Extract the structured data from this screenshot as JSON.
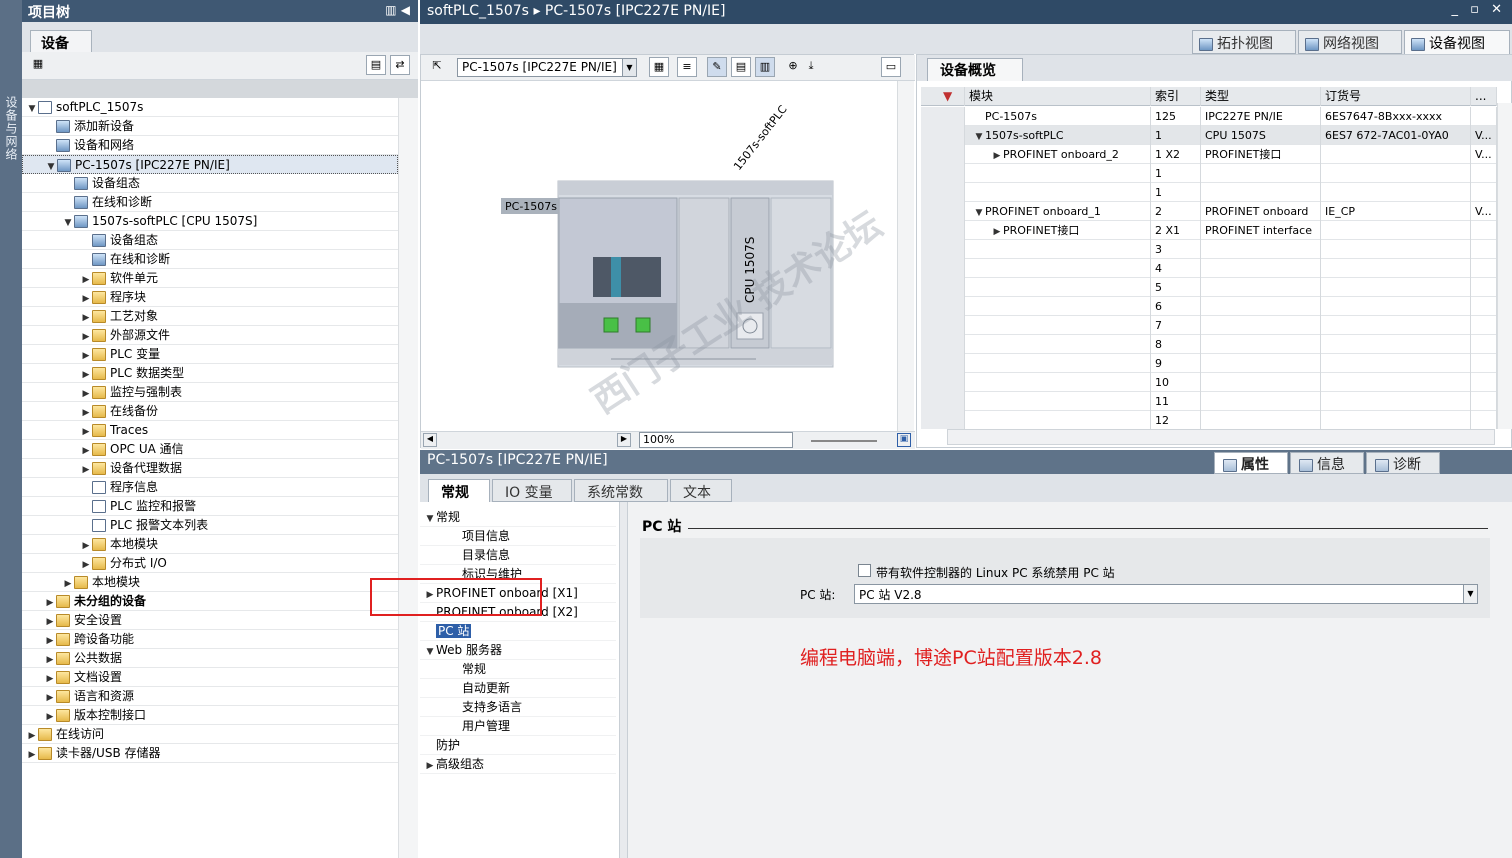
{
  "sidebar_strip": {
    "label": "设备与网络"
  },
  "project_tree": {
    "title": "项目树",
    "tab": "设备",
    "items": [
      {
        "label": "softPLC_1507s",
        "level": 0,
        "arrow": "▼",
        "icon": "doc"
      },
      {
        "label": "添加新设备",
        "level": 1,
        "arrow": "",
        "icon": "dev"
      },
      {
        "label": "设备和网络",
        "level": 1,
        "arrow": "",
        "icon": "dev"
      },
      {
        "label": "PC-1507s [IPC227E PN/IE]",
        "level": 1,
        "arrow": "▼",
        "icon": "dev",
        "selected": true
      },
      {
        "label": "设备组态",
        "level": 2,
        "arrow": "",
        "icon": "dev"
      },
      {
        "label": "在线和诊断",
        "level": 2,
        "arrow": "",
        "icon": "dev"
      },
      {
        "label": "1507s-softPLC [CPU 1507S]",
        "level": 2,
        "arrow": "▼",
        "icon": "dev"
      },
      {
        "label": "设备组态",
        "level": 3,
        "arrow": "",
        "icon": "dev"
      },
      {
        "label": "在线和诊断",
        "level": 3,
        "arrow": "",
        "icon": "dev"
      },
      {
        "label": "软件单元",
        "level": 3,
        "arrow": "▶",
        "icon": "fold"
      },
      {
        "label": "程序块",
        "level": 3,
        "arrow": "▶",
        "icon": "fold"
      },
      {
        "label": "工艺对象",
        "level": 3,
        "arrow": "▶",
        "icon": "fold"
      },
      {
        "label": "外部源文件",
        "level": 3,
        "arrow": "▶",
        "icon": "fold"
      },
      {
        "label": "PLC 变量",
        "level": 3,
        "arrow": "▶",
        "icon": "fold"
      },
      {
        "label": "PLC 数据类型",
        "level": 3,
        "arrow": "▶",
        "icon": "fold"
      },
      {
        "label": "监控与强制表",
        "level": 3,
        "arrow": "▶",
        "icon": "fold"
      },
      {
        "label": "在线备份",
        "level": 3,
        "arrow": "▶",
        "icon": "fold"
      },
      {
        "label": "Traces",
        "level": 3,
        "arrow": "▶",
        "icon": "fold"
      },
      {
        "label": "OPC UA 通信",
        "level": 3,
        "arrow": "▶",
        "icon": "fold"
      },
      {
        "label": "设备代理数据",
        "level": 3,
        "arrow": "▶",
        "icon": "fold"
      },
      {
        "label": "程序信息",
        "level": 3,
        "arrow": "",
        "icon": "doc"
      },
      {
        "label": "PLC 监控和报警",
        "level": 3,
        "arrow": "",
        "icon": "doc"
      },
      {
        "label": "PLC 报警文本列表",
        "level": 3,
        "arrow": "",
        "icon": "doc"
      },
      {
        "label": "本地模块",
        "level": 3,
        "arrow": "▶",
        "icon": "fold"
      },
      {
        "label": "分布式 I/O",
        "level": 3,
        "arrow": "▶",
        "icon": "fold"
      },
      {
        "label": "本地模块",
        "level": 2,
        "arrow": "▶",
        "icon": "fold"
      },
      {
        "label": "未分组的设备",
        "level": 1,
        "arrow": "▶",
        "icon": "fold",
        "bold": true
      },
      {
        "label": "安全设置",
        "level": 1,
        "arrow": "▶",
        "icon": "fold"
      },
      {
        "label": "跨设备功能",
        "level": 1,
        "arrow": "▶",
        "icon": "fold"
      },
      {
        "label": "公共数据",
        "level": 1,
        "arrow": "▶",
        "icon": "fold"
      },
      {
        "label": "文档设置",
        "level": 1,
        "arrow": "▶",
        "icon": "fold"
      },
      {
        "label": "语言和资源",
        "level": 1,
        "arrow": "▶",
        "icon": "fold"
      },
      {
        "label": "版本控制接口",
        "level": 1,
        "arrow": "▶",
        "icon": "fold"
      },
      {
        "label": "在线访问",
        "level": 0,
        "arrow": "▶",
        "icon": "fold"
      },
      {
        "label": "读卡器/USB 存储器",
        "level": 0,
        "arrow": "▶",
        "icon": "fold"
      }
    ]
  },
  "titlebar": {
    "project": "softPLC_1507s",
    "separator": "▸",
    "device": "PC-1507s [IPC227E PN/IE]",
    "controls": "_ ▫ ✕"
  },
  "view_tabs": [
    {
      "label": "拓扑视图",
      "active": false
    },
    {
      "label": "网络视图",
      "active": false
    },
    {
      "label": "设备视图",
      "active": true
    }
  ],
  "device_view": {
    "selector": "PC-1507s [IPC227E PN/IE]",
    "rack_label": "PC-1507s",
    "cpu_name": "1507s-softPLC",
    "cpu_text": "CPU 1507S",
    "zoom": "100%"
  },
  "overview": {
    "tab": "设备概览",
    "columns": [
      "模块",
      "索引",
      "类型",
      "订货号",
      "..."
    ],
    "rows": [
      {
        "module": "PC-1507s",
        "index": "125",
        "type": "IPC227E PN/IE",
        "order": "6ES7647-8Bxxx-xxxx",
        "more": "",
        "indent": 1,
        "arrow": ""
      },
      {
        "module": "1507s-softPLC",
        "index": "1",
        "type": "CPU 1507S",
        "order": "6ES7 672-7AC01-0YA0",
        "more": "V...",
        "indent": 1,
        "arrow": "▼",
        "hl": true
      },
      {
        "module": "PROFINET onboard_2",
        "index": "1 X2",
        "type": "PROFINET接口",
        "order": "",
        "more": "V...",
        "indent": 2,
        "arrow": "▶"
      },
      {
        "module": "",
        "index": "1",
        "type": "",
        "order": "",
        "more": "",
        "indent": 1,
        "arrow": ""
      },
      {
        "module": "",
        "index": "1",
        "type": "",
        "order": "",
        "more": "",
        "indent": 1,
        "arrow": ""
      },
      {
        "module": "PROFINET onboard_1",
        "index": "2",
        "type": "PROFINET onboard",
        "order": "IE_CP",
        "more": "V...",
        "indent": 1,
        "arrow": "▼"
      },
      {
        "module": "PROFINET接口",
        "index": "2 X1",
        "type": "PROFINET interface",
        "order": "",
        "more": "",
        "indent": 2,
        "arrow": "▶"
      },
      {
        "module": "",
        "index": "3",
        "type": "",
        "order": "",
        "more": "",
        "indent": 1,
        "arrow": ""
      },
      {
        "module": "",
        "index": "4",
        "type": "",
        "order": "",
        "more": "",
        "indent": 1,
        "arrow": ""
      },
      {
        "module": "",
        "index": "5",
        "type": "",
        "order": "",
        "more": "",
        "indent": 1,
        "arrow": ""
      },
      {
        "module": "",
        "index": "6",
        "type": "",
        "order": "",
        "more": "",
        "indent": 1,
        "arrow": ""
      },
      {
        "module": "",
        "index": "7",
        "type": "",
        "order": "",
        "more": "",
        "indent": 1,
        "arrow": ""
      },
      {
        "module": "",
        "index": "8",
        "type": "",
        "order": "",
        "more": "",
        "indent": 1,
        "arrow": ""
      },
      {
        "module": "",
        "index": "9",
        "type": "",
        "order": "",
        "more": "",
        "indent": 1,
        "arrow": ""
      },
      {
        "module": "",
        "index": "10",
        "type": "",
        "order": "",
        "more": "",
        "indent": 1,
        "arrow": ""
      },
      {
        "module": "",
        "index": "11",
        "type": "",
        "order": "",
        "more": "",
        "indent": 1,
        "arrow": ""
      },
      {
        "module": "",
        "index": "12",
        "type": "",
        "order": "",
        "more": "",
        "indent": 1,
        "arrow": ""
      }
    ]
  },
  "properties": {
    "title": "PC-1507s [IPC227E PN/IE]",
    "right_tabs": [
      "属性",
      "信息",
      "诊断"
    ],
    "tabs": [
      "常规",
      "IO 变量",
      "系统常数",
      "文本"
    ],
    "nav": [
      {
        "label": "常规",
        "level": 0,
        "arrow": "▼"
      },
      {
        "label": "项目信息",
        "level": 1,
        "arrow": ""
      },
      {
        "label": "目录信息",
        "level": 1,
        "arrow": ""
      },
      {
        "label": "标识与维护",
        "level": 1,
        "arrow": ""
      },
      {
        "label": "PROFINET onboard [X1]",
        "level": 0,
        "arrow": "▶"
      },
      {
        "label": "PROFINET onboard [X2]",
        "level": 0,
        "arrow": ""
      },
      {
        "label": "PC 站",
        "level": 0,
        "arrow": "",
        "selected": true
      },
      {
        "label": "Web 服务器",
        "level": 0,
        "arrow": "▼"
      },
      {
        "label": "常规",
        "level": 1,
        "arrow": ""
      },
      {
        "label": "自动更新",
        "level": 1,
        "arrow": ""
      },
      {
        "label": "支持多语言",
        "level": 1,
        "arrow": ""
      },
      {
        "label": "用户管理",
        "level": 1,
        "arrow": ""
      },
      {
        "label": "防护",
        "level": 0,
        "arrow": ""
      },
      {
        "label": "高级组态",
        "level": 0,
        "arrow": "▶"
      }
    ],
    "section_title": "PC 站",
    "checkbox_label": "带有软件控制器的 Linux PC 系统禁用 PC 站",
    "field_label": "PC 站:",
    "field_value": "PC 站 V2.8",
    "annotation": "编程电脑端，博途PC站配置版本2.8"
  },
  "watermark": "西门子工业 技术论坛",
  "colors": {
    "annotation_red": "#e02020",
    "title_bar": "#2f4a66",
    "selection": "#2e5fa8"
  }
}
